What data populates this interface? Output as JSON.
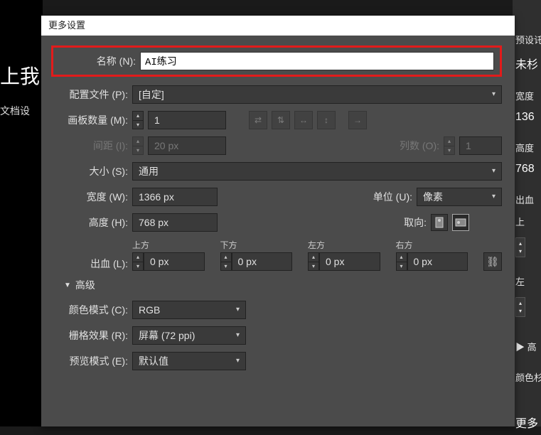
{
  "dialog": {
    "title": "更多设置",
    "name": {
      "label": "名称 (N):",
      "value": "AI练习"
    },
    "profile": {
      "label": "配置文件 (P):",
      "value": "[自定]"
    },
    "artboards": {
      "label": "画板数量 (M):",
      "value": "1"
    },
    "spacing": {
      "label": "间距 (I):",
      "value": "20 px"
    },
    "columns": {
      "label": "列数 (O):",
      "value": "1"
    },
    "size": {
      "label": "大小 (S):",
      "value": "通用"
    },
    "width": {
      "label": "宽度 (W):",
      "value": "1366 px"
    },
    "units": {
      "label": "单位 (U):",
      "value": "像素"
    },
    "height": {
      "label": "高度 (H):",
      "value": "768 px"
    },
    "orientation": {
      "label": "取向:"
    },
    "bleed": {
      "label": "出血 (L):",
      "top": {
        "label": "上方",
        "value": "0 px"
      },
      "bottom": {
        "label": "下方",
        "value": "0 px"
      },
      "left": {
        "label": "左方",
        "value": "0 px"
      },
      "right": {
        "label": "右方",
        "value": "0 px"
      }
    },
    "advanced": "高级",
    "colorMode": {
      "label": "颜色模式 (C):",
      "value": "RGB"
    },
    "raster": {
      "label": "栅格效果 (R):",
      "value": "屏幕 (72 ppi)"
    },
    "preview": {
      "label": "预览模式 (E):",
      "value": "默认值"
    }
  },
  "bg": {
    "leftBig": "上我",
    "leftSub": "文档设",
    "preset": "预设讬",
    "untitled": "未杉",
    "widthLabel": "宽度",
    "widthVal": "136",
    "heightLabel": "高度",
    "heightVal": "768",
    "bleedLabel": "出血",
    "topLabel": "上",
    "leftLabel": "左",
    "advLink": "▶ 高",
    "colorLabel": "颜色杉",
    "moreLabel": "更多"
  }
}
